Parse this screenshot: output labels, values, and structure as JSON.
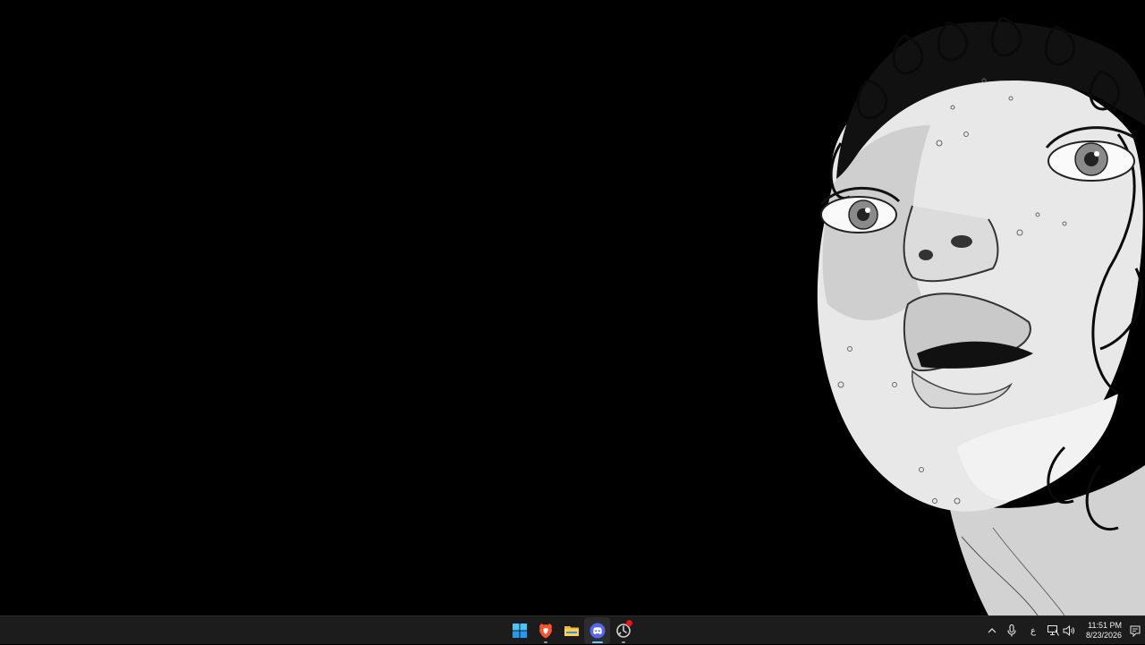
{
  "desktop": {
    "wallpaper": "monochrome line-art portrait"
  },
  "taskbar": {
    "apps": [
      {
        "name": "start",
        "icon": "windows-start-icon",
        "active": false
      },
      {
        "name": "brave",
        "icon": "brave-browser-icon",
        "active": false,
        "running": true
      },
      {
        "name": "file-explorer",
        "icon": "folder-icon",
        "active": false,
        "running": false
      },
      {
        "name": "discord",
        "icon": "discord-icon",
        "active": true,
        "running": true
      },
      {
        "name": "app",
        "icon": "app-icon",
        "active": false,
        "running": true,
        "notification": true
      }
    ],
    "tray": {
      "language": "ع",
      "time": "11:51 PM",
      "date": "8/23/2026"
    },
    "colors": {
      "background": "#1c1c1c",
      "accent": "#60cdff",
      "notification": "#e81123"
    }
  }
}
